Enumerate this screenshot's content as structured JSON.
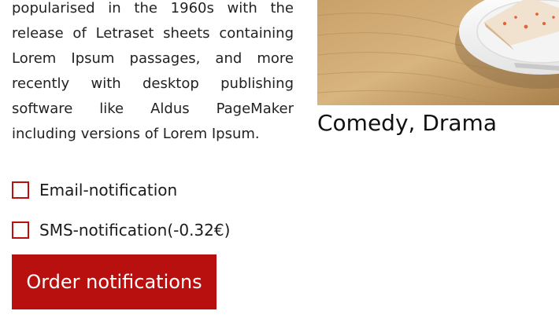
{
  "description_text": "popularised in the 1960s with the release of Letraset sheets containing Lorem Ipsum passages, and more recently with desktop publishing software like Aldus PageMaker including versions of Lorem Ipsum.",
  "movie": {
    "genres": "Comedy, Drama"
  },
  "notifications": {
    "email_label": "Email-notification",
    "sms_label": "SMS-notification(-0.32€)",
    "email_checked": false,
    "sms_checked": false,
    "order_button_label": "Order notifications"
  },
  "colors": {
    "accent": "#b8100f"
  }
}
